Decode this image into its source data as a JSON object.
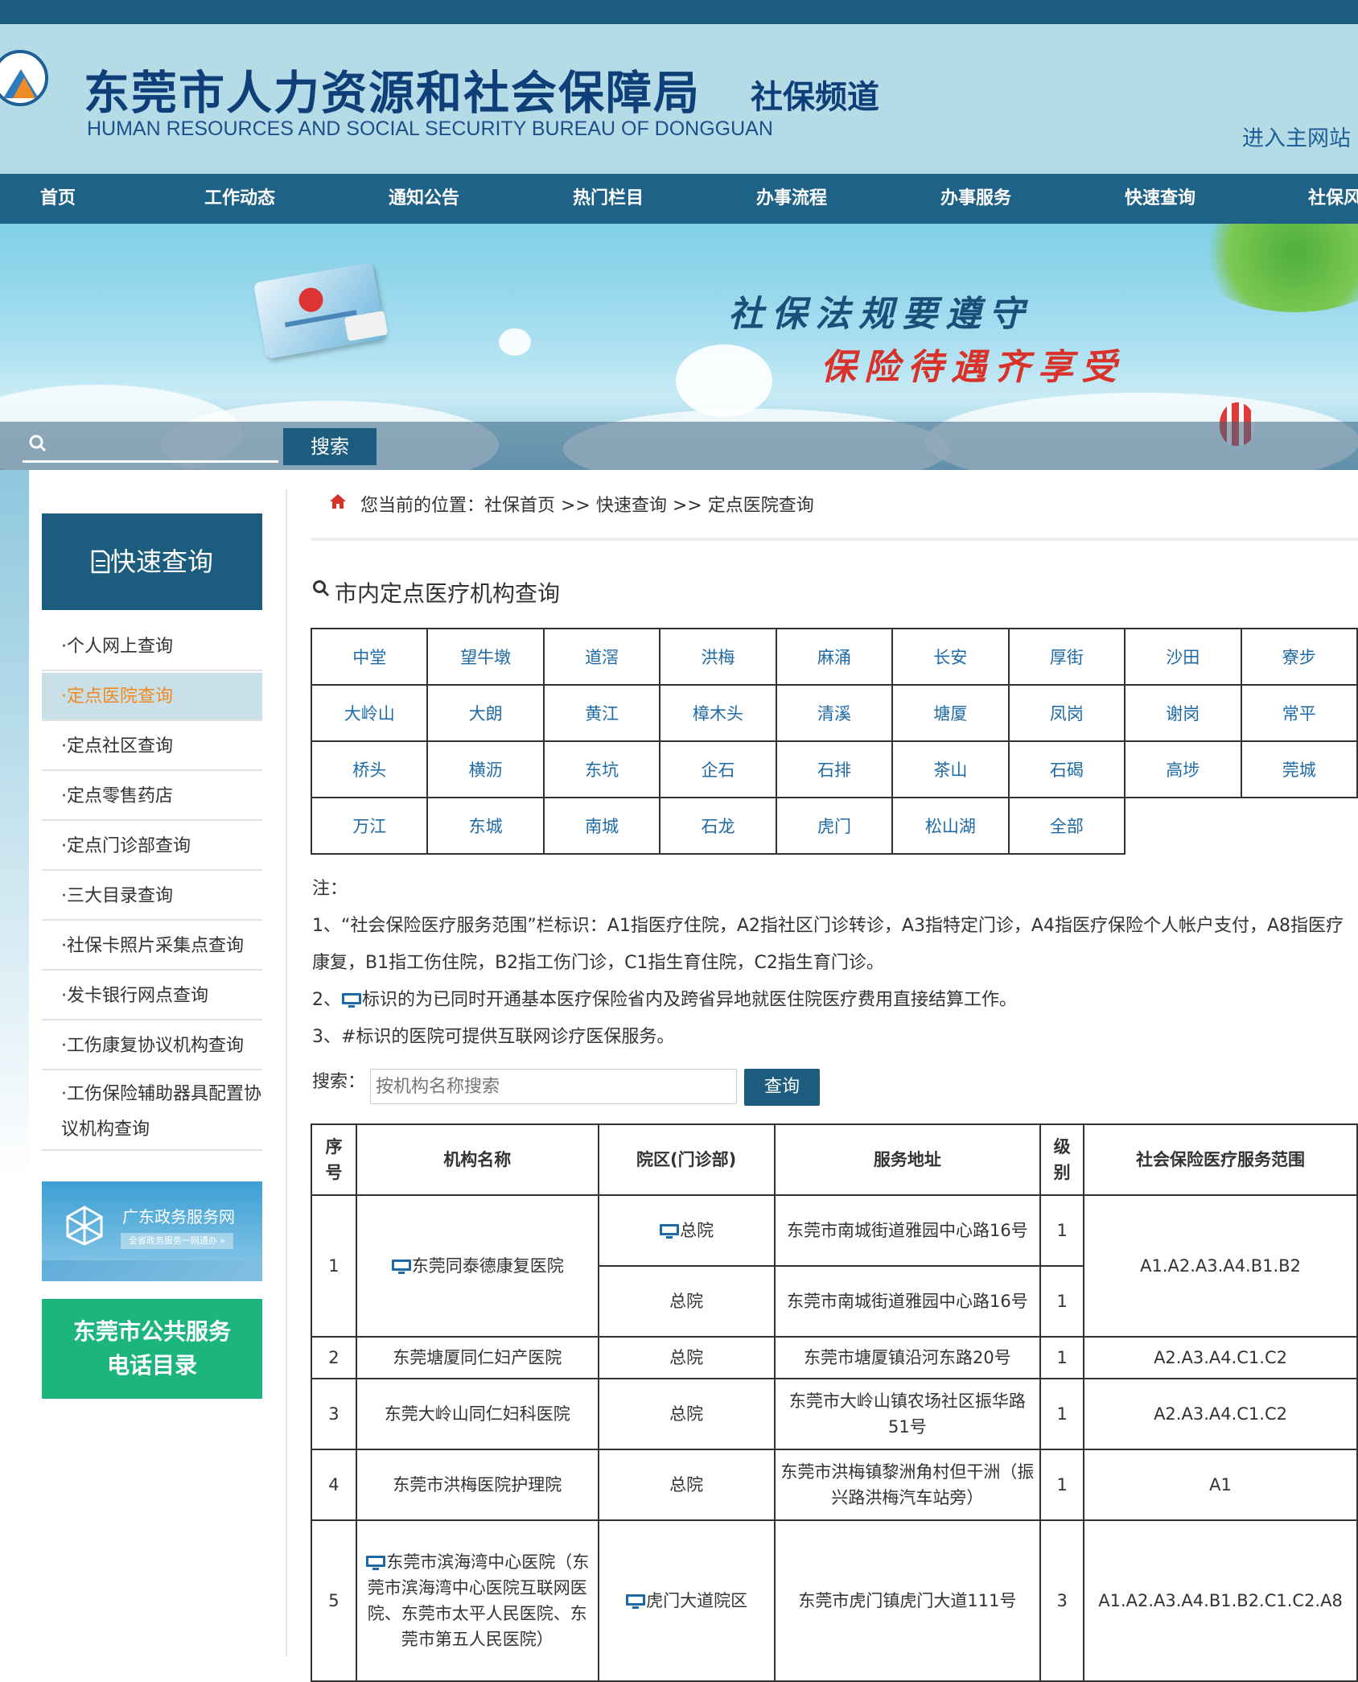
{
  "header": {
    "title": "东莞市人力资源和社会保障局",
    "channel": "社保频道",
    "title_en": "HUMAN RESOURCES AND SOCIAL SECURITY BUREAU OF DONGGUAN",
    "enter_main": "进入主网站"
  },
  "nav": [
    "首页",
    "工作动态",
    "通知公告",
    "热门栏目",
    "办事流程",
    "办事服务",
    "快速查询",
    "社保风"
  ],
  "banner": {
    "slogan1": "社保法规要遵守",
    "slogan2": "保险待遇齐享受",
    "search_button": "搜索"
  },
  "sidebar": {
    "title": "快速查询",
    "items": [
      "·个人网上查询",
      "·定点医院查询",
      "·定点社区查询",
      "·定点零售药店",
      "·定点门诊部查询",
      "·三大目录查询",
      "·社保卡照片采集点查询",
      "·发卡银行网点查询",
      "·工伤康复协议机构查询",
      "·工伤保险辅助器具配置协议机构查询"
    ],
    "active_index": 1,
    "gd_title": "广东政务服务网",
    "gd_sub": "全省政务服务一网通办 »",
    "tel_line1": "东莞市公共服务",
    "tel_line2": "电话目录"
  },
  "main": {
    "breadcrumb": "您当前的位置：社保首页 >> 快速查询 >> 定点医院查询",
    "section_title": "市内定点医疗机构查询",
    "districts": [
      [
        "中堂",
        "望牛墩",
        "道滘",
        "洪梅",
        "麻涌",
        "长安",
        "厚街",
        "沙田",
        "寮步"
      ],
      [
        "大岭山",
        "大朗",
        "黄江",
        "樟木头",
        "清溪",
        "塘厦",
        "凤岗",
        "谢岗",
        "常平"
      ],
      [
        "桥头",
        "横沥",
        "东坑",
        "企石",
        "石排",
        "茶山",
        "石碣",
        "高埗",
        "莞城"
      ],
      [
        "万江",
        "东城",
        "南城",
        "石龙",
        "虎门",
        "松山湖",
        "全部"
      ]
    ],
    "notes": {
      "label": "注：",
      "n1": "1、“社会保险医疗服务范围”栏标识：A1指医疗住院，A2指社区门诊转诊，A3指特定门诊，A4指医疗保险个人帐户支付，A8指医疗康复，B1指工伤住院，B2指工伤门诊，C1指生育住院，C2指生育门诊。",
      "n2_prefix": "2、",
      "n2": "标识的为已同时开通基本医疗保险省内及跨省异地就医住院医疗费用直接结算工作。",
      "n3": "3、#标识的医院可提供互联网诊疗医保服务。"
    },
    "search": {
      "label": "搜索：",
      "placeholder": "按机构名称搜索",
      "button": "查询"
    },
    "table": {
      "headers": [
        "序号",
        "机构名称",
        "院区(门诊部)",
        "服务地址",
        "级别",
        "社会保险医疗服务范围"
      ],
      "rows": [
        {
          "no": "1",
          "name": "东莞同泰德康复医院",
          "campus": "总院",
          "addr": "东莞市南城街道雅园中心路16号",
          "level": "1",
          "scope": "A1.A2.A3.A4.B1.B2"
        },
        {
          "campus": "总院",
          "addr": "东莞市南城街道雅园中心路16号",
          "level": "1"
        },
        {
          "no": "2",
          "name": "东莞塘厦同仁妇产医院",
          "campus": "总院",
          "addr": "东莞市塘厦镇沿河东路20号",
          "level": "1",
          "scope": "A2.A3.A4.C1.C2"
        },
        {
          "no": "3",
          "name": "东莞大岭山同仁妇科医院",
          "campus": "总院",
          "addr": "东莞市大岭山镇农场社区振华路51号",
          "level": "1",
          "scope": "A2.A3.A4.C1.C2"
        },
        {
          "no": "4",
          "name": "东莞市洪梅医院护理院",
          "campus": "总院",
          "addr": "东莞市洪梅镇黎洲角村但干洲（振兴路洪梅汽车站旁）",
          "level": "1",
          "scope": "A1"
        },
        {
          "no": "5",
          "name": "东莞市滨海湾中心医院（东莞市滨海湾中心医院互联网医院、东莞市太平人民医院、东莞市第五人民医院）",
          "campus": "虎门大道院区",
          "addr": "东莞市虎门镇虎门大道111号",
          "level": "3",
          "scope": "A1.A2.A3.A4.B1.B2.C1.C2.A8"
        }
      ]
    }
  },
  "colors": {
    "nav_bg": "#1f6287",
    "header_bg": "#b5dbe6",
    "link_blue": "#1e6aa6",
    "active_orange": "#f08a22",
    "tel_green": "#1bb57d"
  }
}
